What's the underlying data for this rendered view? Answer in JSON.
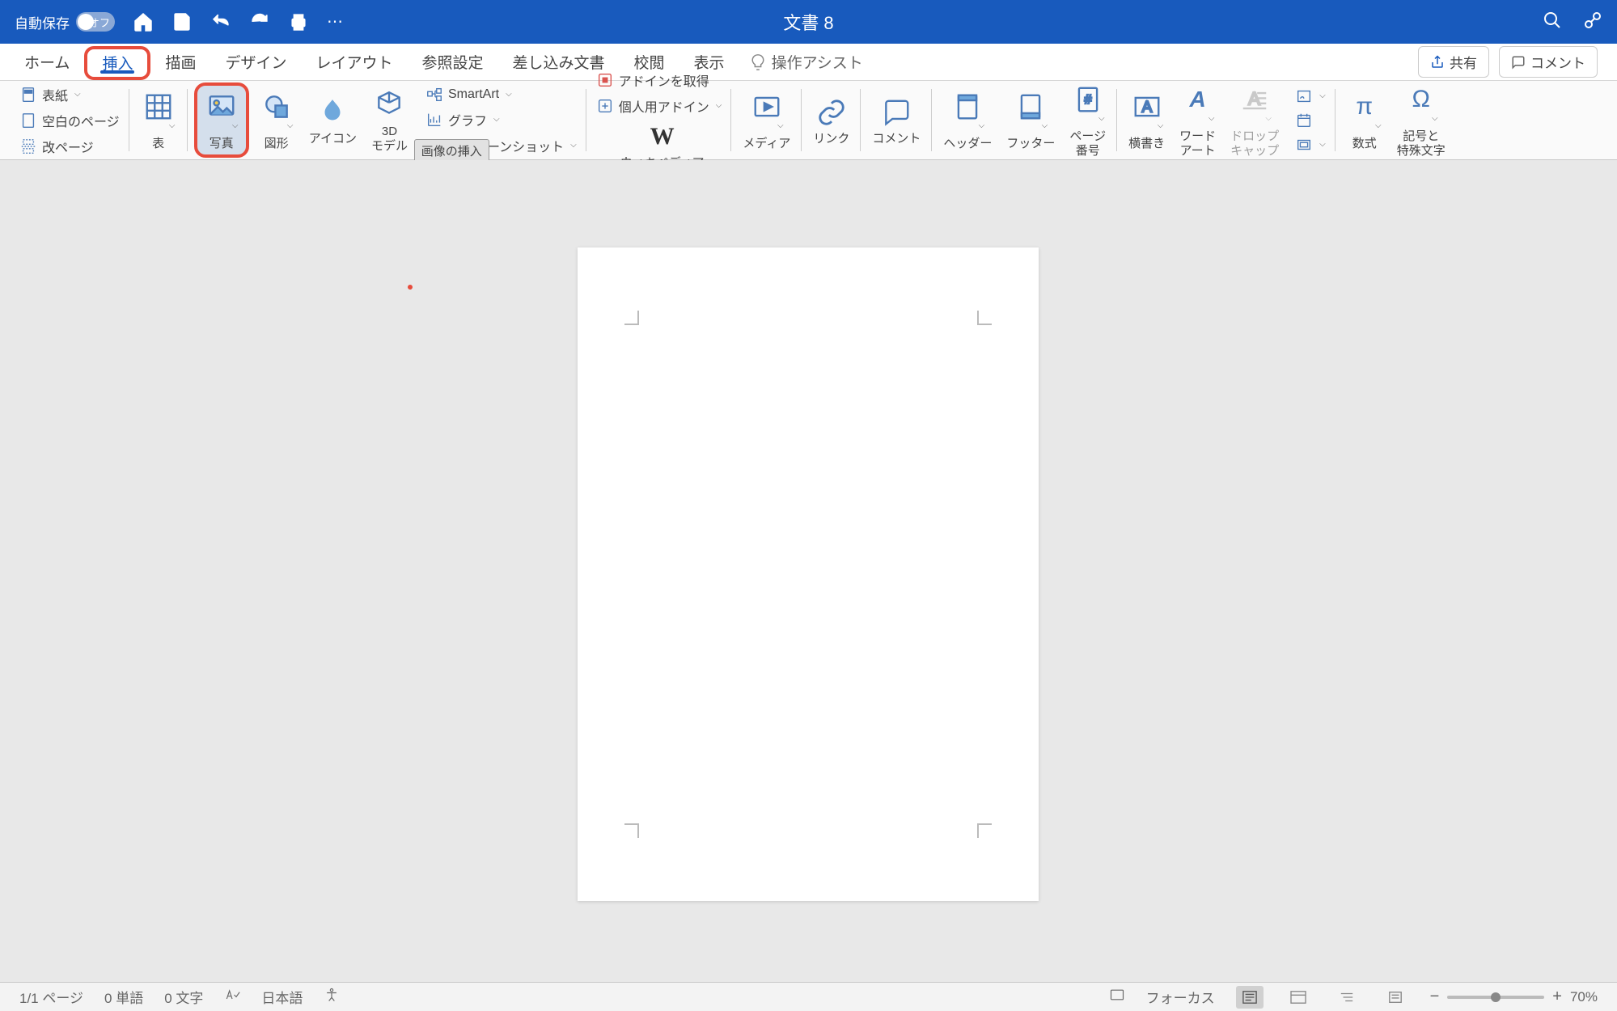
{
  "titlebar": {
    "autosave_label": "自動保存",
    "autosave_toggle_text": "オフ",
    "document_title": "文書 8"
  },
  "tabs": {
    "items": [
      "ホーム",
      "挿入",
      "描画",
      "デザイン",
      "レイアウト",
      "参照設定",
      "差し込み文書",
      "校閲",
      "表示"
    ],
    "active_index": 1,
    "assist": "操作アシスト",
    "share": "共有",
    "comment": "コメント"
  },
  "ribbon": {
    "pages": {
      "cover": "表紙",
      "blank": "空白のページ",
      "break": "改ページ"
    },
    "table": "表",
    "pictures": "写真",
    "pictures_tooltip": "画像の挿入",
    "shapes": "図形",
    "icons": "アイコン",
    "models3d": "3D\nモデル",
    "smartart": "SmartArt",
    "chart": "グラフ",
    "screenshot": "スクリーンショット",
    "get_addins": "アドインを取得",
    "my_addins": "個人用アドイン",
    "wikipedia": "ウィキペディア",
    "media": "メディア",
    "link": "リンク",
    "comment": "コメント",
    "header": "ヘッダー",
    "footer": "フッター",
    "page_number": "ページ\n番号",
    "textbox": "横書き",
    "wordart": "ワード\nアート",
    "dropcap": "ドロップ\nキャップ",
    "equation": "数式",
    "symbol": "記号と\n特殊文字"
  },
  "statusbar": {
    "page": "1/1 ページ",
    "words": "0 単語",
    "chars": "0 文字",
    "language": "日本語",
    "focus": "フォーカス",
    "zoom": "70%"
  }
}
